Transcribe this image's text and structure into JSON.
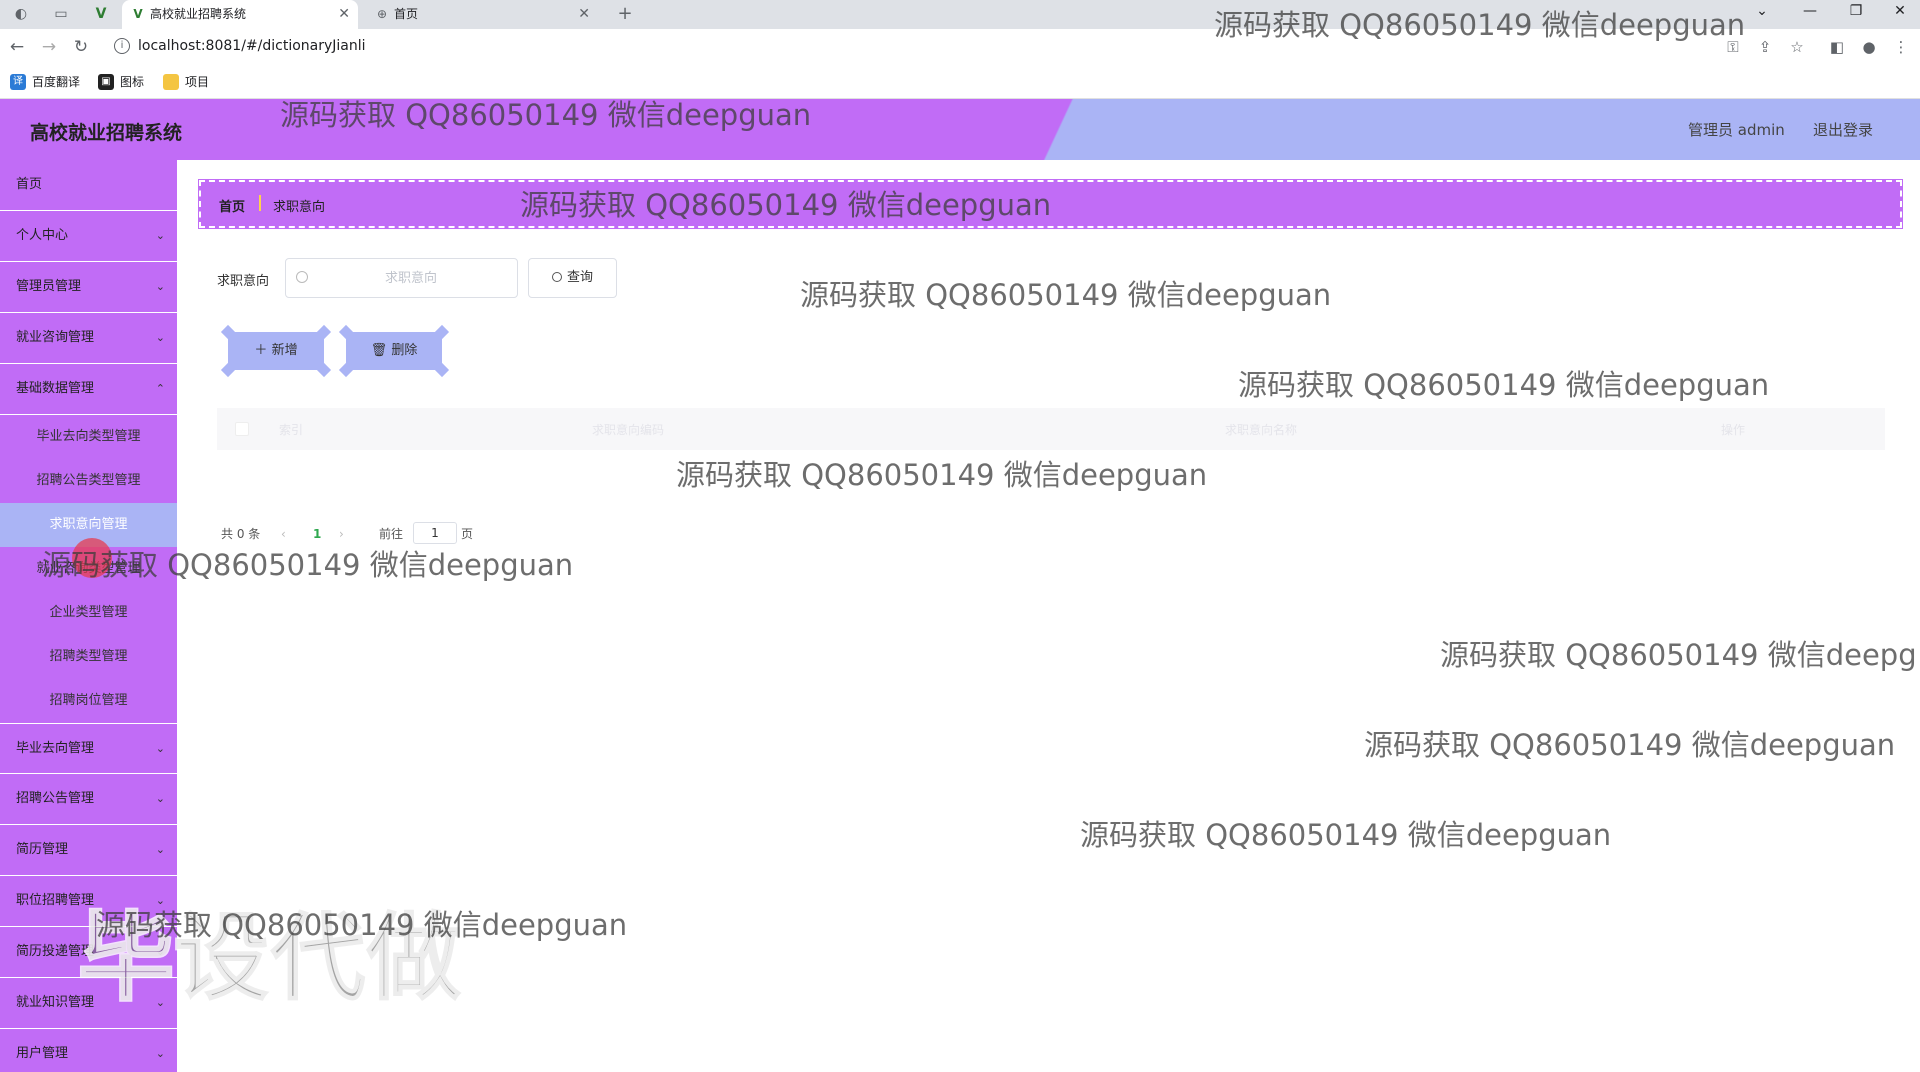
{
  "browser": {
    "tabs": [
      {
        "title": "高校就业招聘系统",
        "active": true
      },
      {
        "title": "首页",
        "active": false
      }
    ],
    "new_tab": "+",
    "url": "localhost:8081/#/dictionaryJianli",
    "bookmarks": [
      {
        "label": "百度翻译",
        "color": "#2b7bd6",
        "icon": "translate-icon"
      },
      {
        "label": "图标",
        "color": "#222222",
        "icon": "image-icon"
      },
      {
        "label": "项目",
        "color": "#f4c542",
        "icon": "folder-icon"
      }
    ]
  },
  "header": {
    "title": "高校就业招聘系统",
    "admin": "管理员 admin",
    "logout": "退出登录",
    "colors": {
      "primary": "#c16cf6",
      "secondary": "#aab4f5"
    }
  },
  "sidebar": {
    "items": [
      {
        "label": "首页",
        "expandable": false
      },
      {
        "label": "个人中心",
        "expandable": true
      },
      {
        "label": "管理员管理",
        "expandable": true
      },
      {
        "label": "就业咨询管理",
        "expandable": true
      },
      {
        "label": "基础数据管理",
        "expandable": true,
        "expanded": true
      }
    ],
    "sub_items": [
      {
        "label": "毕业去向类型管理",
        "active": false
      },
      {
        "label": "招聘公告类型管理",
        "active": false
      },
      {
        "label": "求职意向管理",
        "active": true
      },
      {
        "label": "就业咨询类型管理",
        "active": false
      },
      {
        "label": "企业类型管理",
        "active": false
      },
      {
        "label": "招聘类型管理",
        "active": false
      },
      {
        "label": "招聘岗位管理",
        "active": false
      }
    ],
    "items_after": [
      {
        "label": "毕业去向管理"
      },
      {
        "label": "招聘公告管理"
      },
      {
        "label": "简历管理"
      },
      {
        "label": "职位招聘管理"
      },
      {
        "label": "简历投递管理"
      },
      {
        "label": "就业知识管理"
      },
      {
        "label": "用户管理"
      }
    ]
  },
  "breadcrumb": {
    "home": "首页",
    "current": "求职意向"
  },
  "search": {
    "label": "求职意向",
    "placeholder": "求职意向",
    "value": "",
    "button": "查询"
  },
  "actions": {
    "add": "新增",
    "delete": "删除"
  },
  "table": {
    "columns": [
      "索引",
      "求职意向编码",
      "求职意向名称",
      "操作"
    ],
    "rows": []
  },
  "pagination": {
    "total": "共 0 条",
    "prev": "‹",
    "current_page": "1",
    "next": "›",
    "goto_prefix": "前往",
    "goto_value": "1",
    "goto_suffix": "页"
  },
  "watermarks": {
    "text": "源码获取 QQ86050149 微信deepguan",
    "clipped": "源码获取 QQ86050149 微信deepg",
    "big": "毕设代做"
  }
}
